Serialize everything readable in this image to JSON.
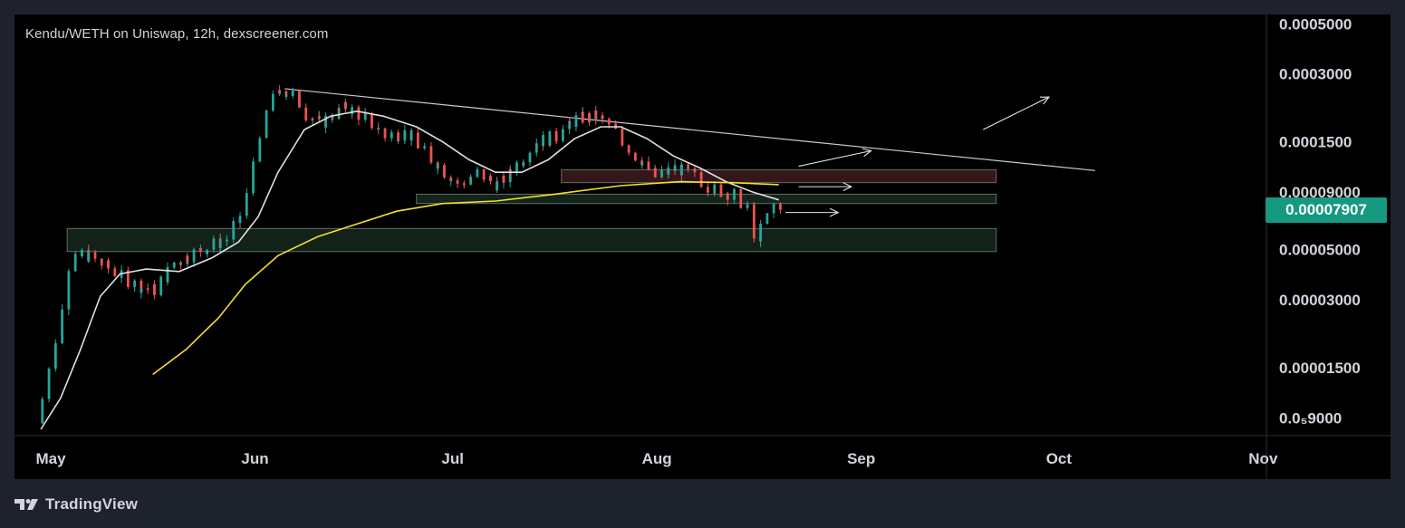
{
  "header": {
    "title": "Kendu/WETH on Uniswap, 12h, dexscreener.com"
  },
  "footer": {
    "brand": "TradingView"
  },
  "price_badge": {
    "value": "0.00007907",
    "color": "#169981"
  },
  "colors": {
    "up": "#26a69a",
    "down": "#ef5350",
    "ma_fast": "#e0e0e0",
    "ma_slow": "#f5e02a",
    "background": "#000000"
  },
  "chart_data": {
    "type": "candlestick",
    "title": "Kendu/WETH on Uniswap, 12h, dexscreener.com",
    "y_scale": "log",
    "ylim": [
      7.5e-06,
      0.00055
    ],
    "xlim": [
      "2024-05-01",
      "2024-11-07"
    ],
    "y_ticks": [
      {
        "value": 0.0005,
        "label": "0.0005000"
      },
      {
        "value": 0.0003,
        "label": "0.0003000"
      },
      {
        "value": 0.00015,
        "label": "0.0001500"
      },
      {
        "value": 9e-05,
        "label": "0.00009000"
      },
      {
        "value": 5e-05,
        "label": "0.00005000"
      },
      {
        "value": 3e-05,
        "label": "0.00003000"
      },
      {
        "value": 1.5e-05,
        "label": "0.00001500"
      },
      {
        "value": 9e-06,
        "label": "0.0₅9000"
      }
    ],
    "x_ticks": [
      {
        "date": "2024-05-01",
        "label": "May"
      },
      {
        "date": "2024-06-01",
        "label": "Jun"
      },
      {
        "date": "2024-07-01",
        "label": "Jul"
      },
      {
        "date": "2024-08-01",
        "label": "Aug"
      },
      {
        "date": "2024-09-01",
        "label": "Sep"
      },
      {
        "date": "2024-10-01",
        "label": "Oct"
      },
      {
        "date": "2024-11-01",
        "label": "Nov"
      }
    ],
    "price_path": [
      [
        "2024-05-05",
        8.5e-06
      ],
      [
        "2024-05-08",
        2e-05
      ],
      [
        "2024-05-10",
        4.2e-05
      ],
      [
        "2024-05-12",
        4.8e-05
      ],
      [
        "2024-05-15",
        4.3e-05
      ],
      [
        "2024-05-18",
        3.8e-05
      ],
      [
        "2024-05-21",
        3.4e-05
      ],
      [
        "2024-05-23",
        3.3e-05
      ],
      [
        "2024-05-26",
        4.4e-05
      ],
      [
        "2024-05-30",
        5e-05
      ],
      [
        "2024-06-03",
        5.6e-05
      ],
      [
        "2024-06-05",
        7e-05
      ],
      [
        "2024-06-07",
        0.000115
      ],
      [
        "2024-06-09",
        0.00021
      ],
      [
        "2024-06-11",
        0.000255
      ],
      [
        "2024-06-13",
        0.000245
      ],
      [
        "2024-06-15",
        0.0002
      ],
      [
        "2024-06-17",
        0.00018
      ],
      [
        "2024-06-19",
        0.0002
      ],
      [
        "2024-06-21",
        0.000215
      ],
      [
        "2024-06-24",
        0.00019
      ],
      [
        "2024-06-27",
        0.00016
      ],
      [
        "2024-06-30",
        0.000165
      ],
      [
        "2024-07-03",
        0.000135
      ],
      [
        "2024-07-06",
        0.00011
      ],
      [
        "2024-07-08",
        9.6e-05
      ],
      [
        "2024-07-11",
        0.00011
      ],
      [
        "2024-07-14",
        9.6e-05
      ],
      [
        "2024-07-17",
        0.00012
      ],
      [
        "2024-07-20",
        0.00015
      ],
      [
        "2024-07-23",
        0.00016
      ],
      [
        "2024-07-26",
        0.00019
      ],
      [
        "2024-07-29",
        0.000195
      ],
      [
        "2024-08-01",
        0.000165
      ],
      [
        "2024-08-04",
        0.00013
      ],
      [
        "2024-08-07",
        0.000105
      ],
      [
        "2024-08-10",
        0.000115
      ],
      [
        "2024-08-13",
        0.000105
      ],
      [
        "2024-08-16",
        9.2e-05
      ],
      [
        "2024-08-19",
        8.8e-05
      ],
      [
        "2024-08-21",
        7.5e-05
      ],
      [
        "2024-08-22",
        5.4e-05
      ],
      [
        "2024-08-24",
        7e-05
      ],
      [
        "2024-08-25",
        7.9e-05
      ]
    ],
    "moving_averages": [
      {
        "color": "#e0e0e0",
        "points": [
          [
            "2024-05-05",
            8e-06
          ],
          [
            "2024-05-08",
            1.1e-05
          ],
          [
            "2024-05-11",
            1.8e-05
          ],
          [
            "2024-05-14",
            3.1e-05
          ],
          [
            "2024-05-17",
            3.9e-05
          ],
          [
            "2024-05-21",
            4.1e-05
          ],
          [
            "2024-05-26",
            4e-05
          ],
          [
            "2024-05-31",
            4.6e-05
          ],
          [
            "2024-06-04",
            5.4e-05
          ],
          [
            "2024-06-07",
            7e-05
          ],
          [
            "2024-06-10",
            0.00011
          ],
          [
            "2024-06-14",
            0.00017
          ],
          [
            "2024-06-18",
            0.000195
          ],
          [
            "2024-06-22",
            0.000205
          ],
          [
            "2024-06-26",
            0.000195
          ],
          [
            "2024-07-01",
            0.000175
          ],
          [
            "2024-07-05",
            0.00015
          ],
          [
            "2024-07-09",
            0.000125
          ],
          [
            "2024-07-13",
            0.00011
          ],
          [
            "2024-07-17",
            0.00011
          ],
          [
            "2024-07-21",
            0.000125
          ],
          [
            "2024-07-25",
            0.000155
          ],
          [
            "2024-07-29",
            0.000175
          ],
          [
            "2024-08-01",
            0.000175
          ],
          [
            "2024-08-05",
            0.000155
          ],
          [
            "2024-08-09",
            0.00013
          ],
          [
            "2024-08-13",
            0.000115
          ],
          [
            "2024-08-17",
            0.0001
          ],
          [
            "2024-08-21",
            9e-05
          ],
          [
            "2024-08-25",
            8.3e-05
          ]
        ]
      },
      {
        "color": "#f5e02a",
        "points": [
          [
            "2024-05-22",
            1.4e-05
          ],
          [
            "2024-05-27",
            1.8e-05
          ],
          [
            "2024-06-01",
            2.5e-05
          ],
          [
            "2024-06-05",
            3.5e-05
          ],
          [
            "2024-06-10",
            4.7e-05
          ],
          [
            "2024-06-16",
            5.7e-05
          ],
          [
            "2024-06-22",
            6.5e-05
          ],
          [
            "2024-06-28",
            7.4e-05
          ],
          [
            "2024-07-05",
            8e-05
          ],
          [
            "2024-07-13",
            8.2e-05
          ],
          [
            "2024-07-22",
            8.8e-05
          ],
          [
            "2024-08-01",
            9.6e-05
          ],
          [
            "2024-08-10",
            0.0001
          ],
          [
            "2024-08-18",
            9.9e-05
          ],
          [
            "2024-08-25",
            9.7e-05
          ]
        ]
      }
    ],
    "annotations": {
      "trendline": [
        [
          "2024-06-11",
          0.000258
        ],
        [
          "2024-10-12",
          0.000112
        ]
      ],
      "zones": [
        {
          "from": "2024-07-23",
          "to": "2024-09-27",
          "y_top": 0.000113,
          "y_bottom": 9.9e-05,
          "color": "#3a1a1e"
        },
        {
          "from": "2024-07-01",
          "to": "2024-09-27",
          "y_top": 8.8e-05,
          "y_bottom": 8e-05,
          "color": "#162a1f"
        },
        {
          "from": "2024-05-09",
          "to": "2024-09-27",
          "y_top": 6.2e-05,
          "y_bottom": 4.9e-05,
          "color": "#14261b"
        }
      ],
      "arrows": [
        [
          [
            "2024-08-28",
            0.000117
          ],
          [
            "2024-09-08",
            0.000137
          ]
        ],
        [
          [
            "2024-08-28",
            9.5e-05
          ],
          [
            "2024-09-05",
            9.5e-05
          ]
        ],
        [
          [
            "2024-08-26",
            7.3e-05
          ],
          [
            "2024-09-03",
            7.3e-05
          ]
        ],
        [
          [
            "2024-09-25",
            0.00017
          ],
          [
            "2024-10-05",
            0.000237
          ]
        ]
      ]
    }
  }
}
